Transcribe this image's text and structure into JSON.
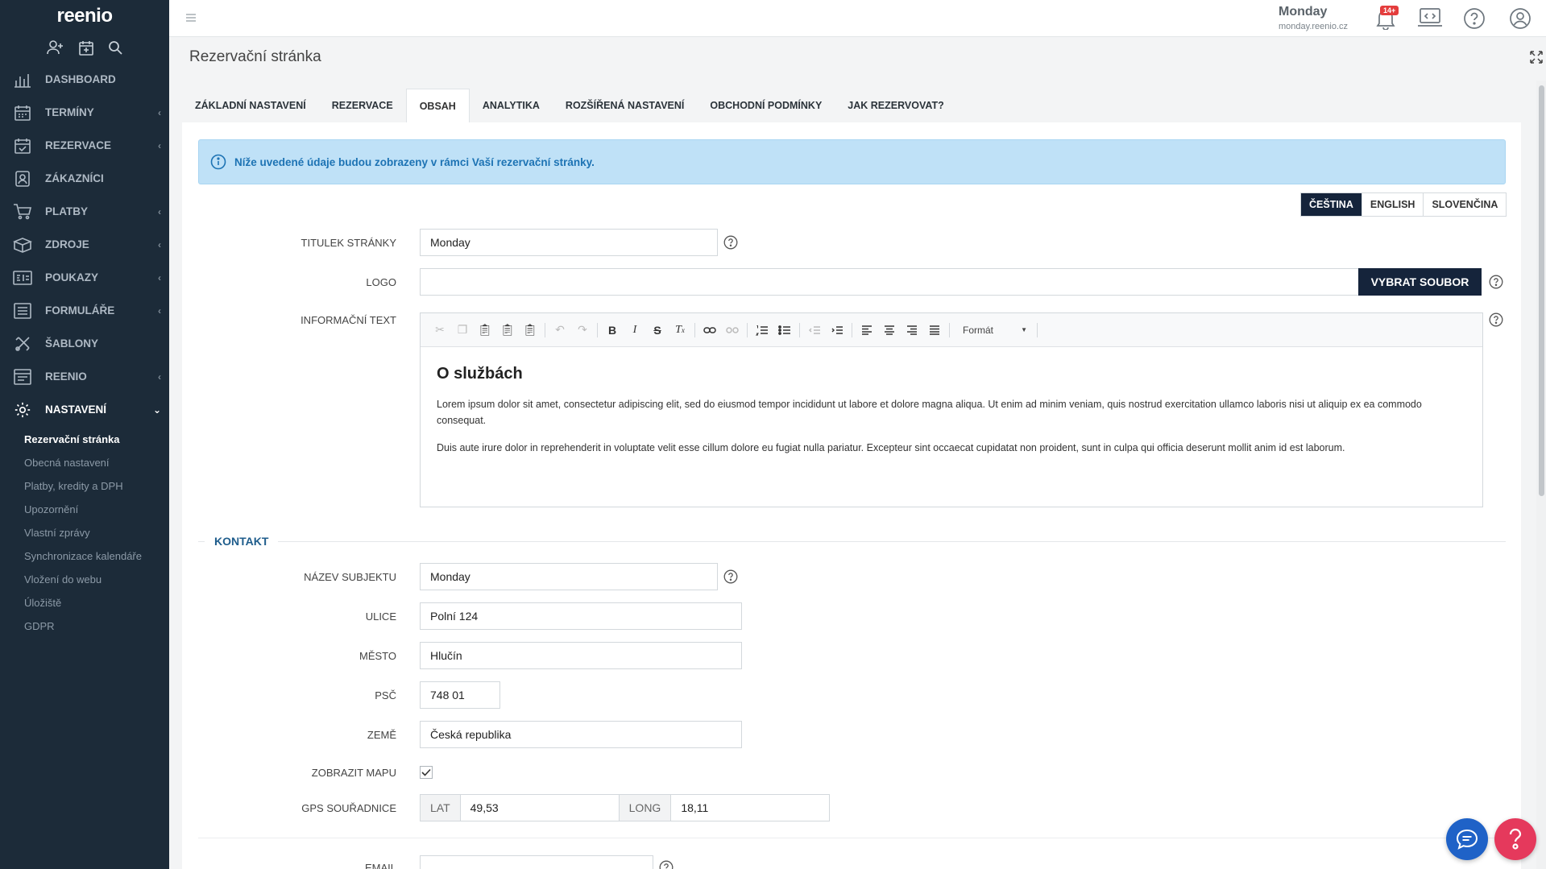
{
  "brand": "reenio",
  "sidebar": {
    "items": [
      {
        "label": "DASHBOARD",
        "icon": "chart-icon",
        "chevron": ""
      },
      {
        "label": "TERMÍNY",
        "icon": "calendar-icon",
        "chevron": "‹"
      },
      {
        "label": "REZERVACE",
        "icon": "calendar-check-icon",
        "chevron": "‹"
      },
      {
        "label": "ZÁKAZNÍCI",
        "icon": "contacts-icon",
        "chevron": ""
      },
      {
        "label": "PLATBY",
        "icon": "cart-icon",
        "chevron": "‹"
      },
      {
        "label": "ZDROJE",
        "icon": "box-icon",
        "chevron": "‹"
      },
      {
        "label": "POUKAZY",
        "icon": "voucher-icon",
        "chevron": "‹"
      },
      {
        "label": "FORMULÁŘE",
        "icon": "form-icon",
        "chevron": "‹"
      },
      {
        "label": "ŠABLONY",
        "icon": "template-icon",
        "chevron": ""
      },
      {
        "label": "REENIO",
        "icon": "window-icon",
        "chevron": "‹"
      },
      {
        "label": "NASTAVENÍ",
        "icon": "gear-icon",
        "chevron": "⌄"
      }
    ],
    "subitems": [
      "Rezervační stránka",
      "Obecná nastavení",
      "Platby, kredity a DPH",
      "Upozornění",
      "Vlastní zprávy",
      "Synchronizace kalendáře",
      "Vložení do webu",
      "Úložiště",
      "GDPR"
    ]
  },
  "topbar": {
    "account_name": "Monday",
    "account_domain": "monday.reenio.cz",
    "notification_badge": "14+"
  },
  "page": {
    "title": "Rezervační stránka"
  },
  "tabs": [
    "ZÁKLADNÍ NASTAVENÍ",
    "REZERVACE",
    "OBSAH",
    "ANALYTIKA",
    "ROZŠÍŘENÁ NASTAVENÍ",
    "OBCHODNÍ PODMÍNKY",
    "JAK REZERVOVAT?"
  ],
  "alert": "Níže uvedené údaje budou zobrazeny v rámci Vaší rezervační stránky.",
  "languages": [
    "ČEŠTINA",
    "ENGLISH",
    "SLOVENČINA"
  ],
  "form": {
    "title_label": "TITULEK STRÁNKY",
    "title_value": "Monday",
    "logo_label": "LOGO",
    "logo_value": "",
    "logo_button": "VYBRAT SOUBOR",
    "info_label": "INFORMAČNÍ TEXT",
    "format_label": "Formát",
    "editor_heading": "O službách",
    "editor_p1": "Lorem ipsum dolor sit amet, consectetur adipiscing elit, sed do eiusmod tempor incididunt ut labore et dolore magna aliqua. Ut enim ad minim veniam, quis nostrud exercitation ullamco laboris nisi ut aliquip ex ea commodo consequat.",
    "editor_p2": "Duis aute irure dolor in reprehenderit in voluptate velit esse cillum dolore eu fugiat nulla pariatur. Excepteur sint occaecat cupidatat non proident, sunt in culpa qui officia deserunt mollit anim id est laborum."
  },
  "contact": {
    "section_title": "KONTAKT",
    "name_label": "NÁZEV SUBJEKTU",
    "name_value": "Monday",
    "street_label": "ULICE",
    "street_value": "Polní 124",
    "city_label": "MĚSTO",
    "city_value": "Hlučín",
    "zip_label": "PSČ",
    "zip_value": "748 01",
    "country_label": "ZEMĚ",
    "country_value": "Česká republika",
    "map_label": "ZOBRAZIT MAPU",
    "map_checked": true,
    "gps_label": "GPS SOUŘADNICE",
    "lat_label": "LAT",
    "lat_value": "49,53",
    "long_label": "LONG",
    "long_value": "18,11",
    "email_label": "EMAIL",
    "email_value": ""
  },
  "colors": {
    "sidebar_bg": "#1c2b39",
    "accent_dark": "#15243b",
    "alert_bg": "#bfe1f7",
    "alert_text": "#1d73b4",
    "badge": "#e43d3d",
    "chat_fab": "#1f62c7",
    "help_fab": "#e5395c"
  }
}
